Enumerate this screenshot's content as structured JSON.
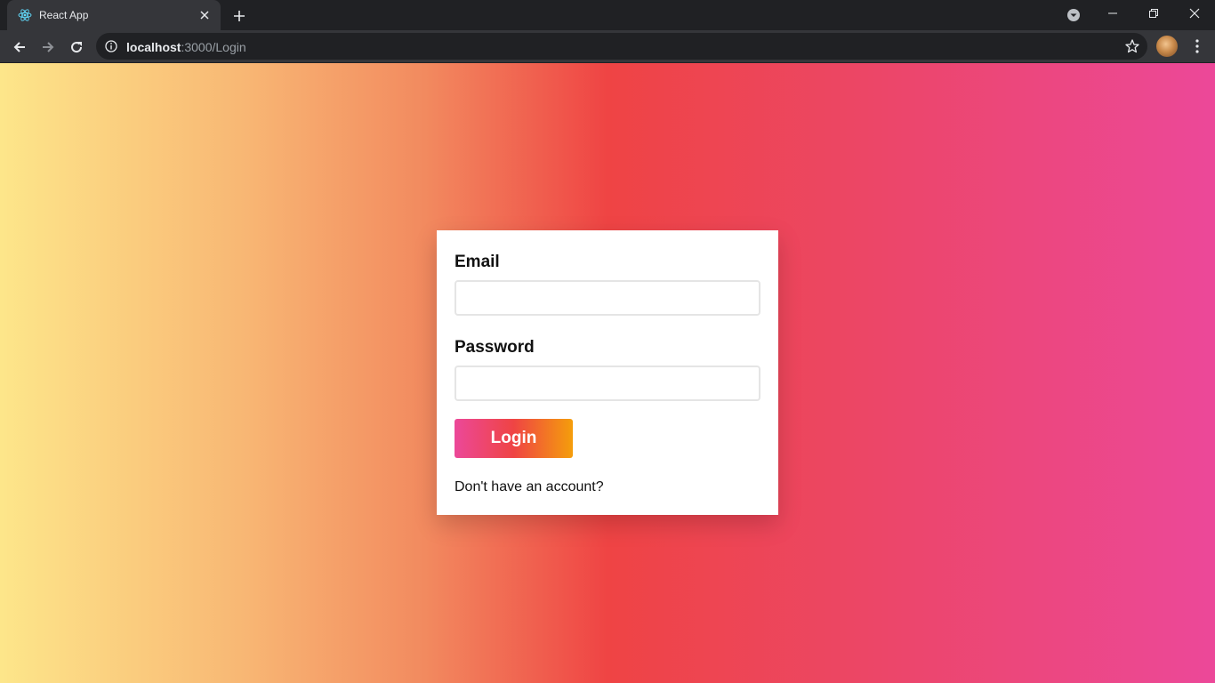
{
  "browser": {
    "tab_title": "React App",
    "favicon": "react-icon",
    "url_host": "localhost",
    "url_path": ":3000/Login"
  },
  "login_form": {
    "email_label": "Email",
    "email_value": "",
    "password_label": "Password",
    "password_value": "",
    "submit_label": "Login",
    "signup_prompt": "Don't have an account?"
  },
  "colors": {
    "gradient_left": "#fde68a",
    "gradient_mid": "#ef4444",
    "gradient_right": "#ec4899",
    "button_start": "#ec4899",
    "button_end": "#f59e0b"
  }
}
